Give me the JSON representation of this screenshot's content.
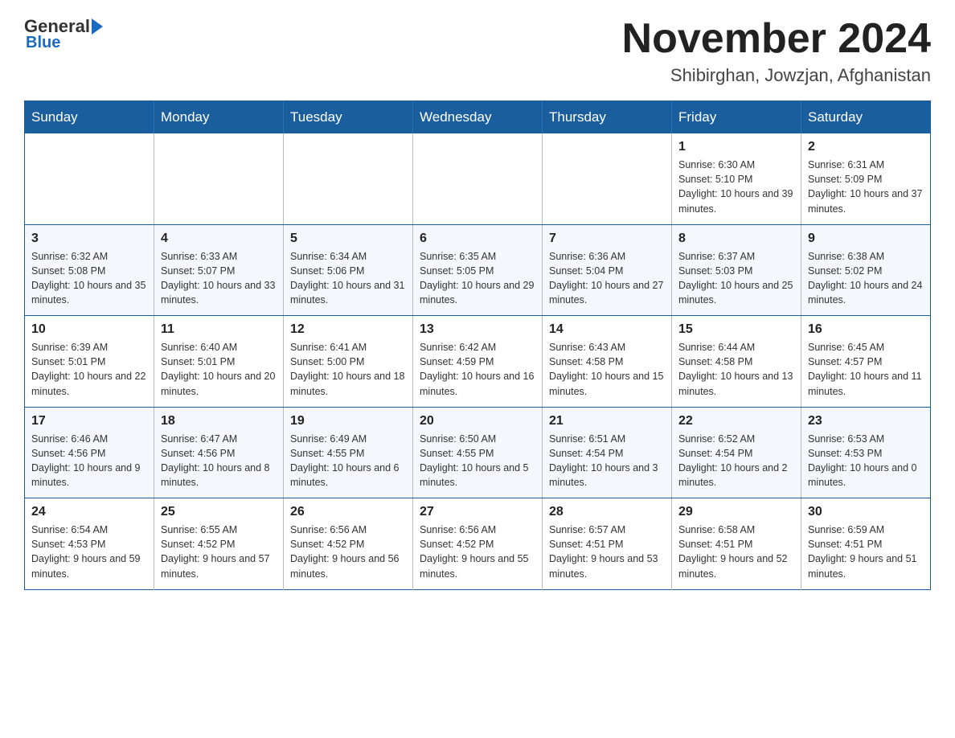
{
  "logo": {
    "general": "General",
    "blue": "Blue",
    "tagline": "Blue"
  },
  "header": {
    "title": "November 2024",
    "subtitle": "Shibirghan, Jowzjan, Afghanistan"
  },
  "weekdays": [
    "Sunday",
    "Monday",
    "Tuesday",
    "Wednesday",
    "Thursday",
    "Friday",
    "Saturday"
  ],
  "weeks": [
    [
      {
        "day": "",
        "sunrise": "",
        "sunset": "",
        "daylight": ""
      },
      {
        "day": "",
        "sunrise": "",
        "sunset": "",
        "daylight": ""
      },
      {
        "day": "",
        "sunrise": "",
        "sunset": "",
        "daylight": ""
      },
      {
        "day": "",
        "sunrise": "",
        "sunset": "",
        "daylight": ""
      },
      {
        "day": "",
        "sunrise": "",
        "sunset": "",
        "daylight": ""
      },
      {
        "day": "1",
        "sunrise": "Sunrise: 6:30 AM",
        "sunset": "Sunset: 5:10 PM",
        "daylight": "Daylight: 10 hours and 39 minutes."
      },
      {
        "day": "2",
        "sunrise": "Sunrise: 6:31 AM",
        "sunset": "Sunset: 5:09 PM",
        "daylight": "Daylight: 10 hours and 37 minutes."
      }
    ],
    [
      {
        "day": "3",
        "sunrise": "Sunrise: 6:32 AM",
        "sunset": "Sunset: 5:08 PM",
        "daylight": "Daylight: 10 hours and 35 minutes."
      },
      {
        "day": "4",
        "sunrise": "Sunrise: 6:33 AM",
        "sunset": "Sunset: 5:07 PM",
        "daylight": "Daylight: 10 hours and 33 minutes."
      },
      {
        "day": "5",
        "sunrise": "Sunrise: 6:34 AM",
        "sunset": "Sunset: 5:06 PM",
        "daylight": "Daylight: 10 hours and 31 minutes."
      },
      {
        "day": "6",
        "sunrise": "Sunrise: 6:35 AM",
        "sunset": "Sunset: 5:05 PM",
        "daylight": "Daylight: 10 hours and 29 minutes."
      },
      {
        "day": "7",
        "sunrise": "Sunrise: 6:36 AM",
        "sunset": "Sunset: 5:04 PM",
        "daylight": "Daylight: 10 hours and 27 minutes."
      },
      {
        "day": "8",
        "sunrise": "Sunrise: 6:37 AM",
        "sunset": "Sunset: 5:03 PM",
        "daylight": "Daylight: 10 hours and 25 minutes."
      },
      {
        "day": "9",
        "sunrise": "Sunrise: 6:38 AM",
        "sunset": "Sunset: 5:02 PM",
        "daylight": "Daylight: 10 hours and 24 minutes."
      }
    ],
    [
      {
        "day": "10",
        "sunrise": "Sunrise: 6:39 AM",
        "sunset": "Sunset: 5:01 PM",
        "daylight": "Daylight: 10 hours and 22 minutes."
      },
      {
        "day": "11",
        "sunrise": "Sunrise: 6:40 AM",
        "sunset": "Sunset: 5:01 PM",
        "daylight": "Daylight: 10 hours and 20 minutes."
      },
      {
        "day": "12",
        "sunrise": "Sunrise: 6:41 AM",
        "sunset": "Sunset: 5:00 PM",
        "daylight": "Daylight: 10 hours and 18 minutes."
      },
      {
        "day": "13",
        "sunrise": "Sunrise: 6:42 AM",
        "sunset": "Sunset: 4:59 PM",
        "daylight": "Daylight: 10 hours and 16 minutes."
      },
      {
        "day": "14",
        "sunrise": "Sunrise: 6:43 AM",
        "sunset": "Sunset: 4:58 PM",
        "daylight": "Daylight: 10 hours and 15 minutes."
      },
      {
        "day": "15",
        "sunrise": "Sunrise: 6:44 AM",
        "sunset": "Sunset: 4:58 PM",
        "daylight": "Daylight: 10 hours and 13 minutes."
      },
      {
        "day": "16",
        "sunrise": "Sunrise: 6:45 AM",
        "sunset": "Sunset: 4:57 PM",
        "daylight": "Daylight: 10 hours and 11 minutes."
      }
    ],
    [
      {
        "day": "17",
        "sunrise": "Sunrise: 6:46 AM",
        "sunset": "Sunset: 4:56 PM",
        "daylight": "Daylight: 10 hours and 9 minutes."
      },
      {
        "day": "18",
        "sunrise": "Sunrise: 6:47 AM",
        "sunset": "Sunset: 4:56 PM",
        "daylight": "Daylight: 10 hours and 8 minutes."
      },
      {
        "day": "19",
        "sunrise": "Sunrise: 6:49 AM",
        "sunset": "Sunset: 4:55 PM",
        "daylight": "Daylight: 10 hours and 6 minutes."
      },
      {
        "day": "20",
        "sunrise": "Sunrise: 6:50 AM",
        "sunset": "Sunset: 4:55 PM",
        "daylight": "Daylight: 10 hours and 5 minutes."
      },
      {
        "day": "21",
        "sunrise": "Sunrise: 6:51 AM",
        "sunset": "Sunset: 4:54 PM",
        "daylight": "Daylight: 10 hours and 3 minutes."
      },
      {
        "day": "22",
        "sunrise": "Sunrise: 6:52 AM",
        "sunset": "Sunset: 4:54 PM",
        "daylight": "Daylight: 10 hours and 2 minutes."
      },
      {
        "day": "23",
        "sunrise": "Sunrise: 6:53 AM",
        "sunset": "Sunset: 4:53 PM",
        "daylight": "Daylight: 10 hours and 0 minutes."
      }
    ],
    [
      {
        "day": "24",
        "sunrise": "Sunrise: 6:54 AM",
        "sunset": "Sunset: 4:53 PM",
        "daylight": "Daylight: 9 hours and 59 minutes."
      },
      {
        "day": "25",
        "sunrise": "Sunrise: 6:55 AM",
        "sunset": "Sunset: 4:52 PM",
        "daylight": "Daylight: 9 hours and 57 minutes."
      },
      {
        "day": "26",
        "sunrise": "Sunrise: 6:56 AM",
        "sunset": "Sunset: 4:52 PM",
        "daylight": "Daylight: 9 hours and 56 minutes."
      },
      {
        "day": "27",
        "sunrise": "Sunrise: 6:56 AM",
        "sunset": "Sunset: 4:52 PM",
        "daylight": "Daylight: 9 hours and 55 minutes."
      },
      {
        "day": "28",
        "sunrise": "Sunrise: 6:57 AM",
        "sunset": "Sunset: 4:51 PM",
        "daylight": "Daylight: 9 hours and 53 minutes."
      },
      {
        "day": "29",
        "sunrise": "Sunrise: 6:58 AM",
        "sunset": "Sunset: 4:51 PM",
        "daylight": "Daylight: 9 hours and 52 minutes."
      },
      {
        "day": "30",
        "sunrise": "Sunrise: 6:59 AM",
        "sunset": "Sunset: 4:51 PM",
        "daylight": "Daylight: 9 hours and 51 minutes."
      }
    ]
  ]
}
